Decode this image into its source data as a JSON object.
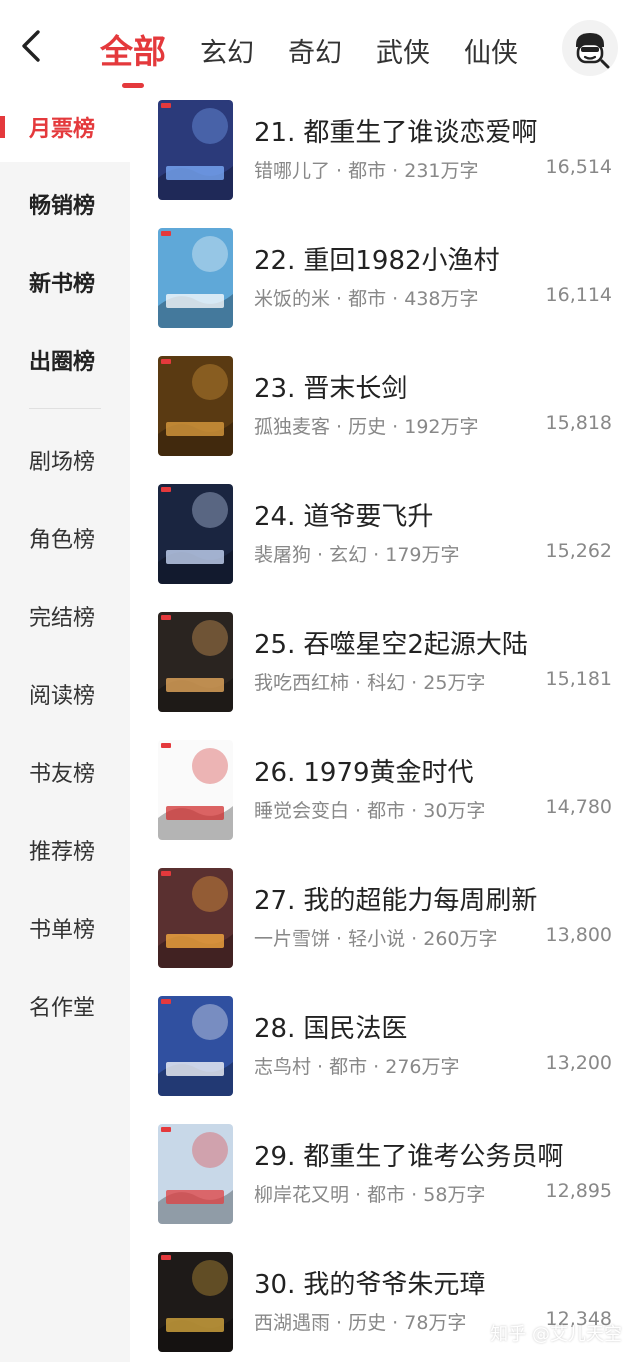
{
  "header": {
    "tabs": [
      {
        "label": "全部",
        "active": true
      },
      {
        "label": "玄幻",
        "active": false
      },
      {
        "label": "奇幻",
        "active": false
      },
      {
        "label": "武侠",
        "active": false
      },
      {
        "label": "仙侠",
        "active": false
      }
    ],
    "accent_color": "#e4393c"
  },
  "sidebar": {
    "items": [
      {
        "label": "月票榜"
      },
      {
        "label": "畅销榜"
      },
      {
        "label": "新书榜"
      },
      {
        "label": "出圈榜"
      },
      {
        "label": "剧场榜"
      },
      {
        "label": "角色榜"
      },
      {
        "label": "完结榜"
      },
      {
        "label": "阅读榜"
      },
      {
        "label": "书友榜"
      },
      {
        "label": "推荐榜"
      },
      {
        "label": "书单榜"
      },
      {
        "label": "名作堂"
      }
    ]
  },
  "books": [
    {
      "rank": "21.",
      "title": "都重生了谁谈恋爱啊",
      "meta": "错哪儿了 · 都市 · 231万字",
      "votes": "16,514",
      "cover_color": "#2b3a7a",
      "cover_accent": "#7fb0ff"
    },
    {
      "rank": "22.",
      "title": "重回1982小渔村",
      "meta": "米饭的米 · 都市 · 438万字",
      "votes": "16,114",
      "cover_color": "#5fa8d8",
      "cover_accent": "#ffffff"
    },
    {
      "rank": "23.",
      "title": "晋末长剑",
      "meta": "孤独麦客 · 历史 · 192万字",
      "votes": "15,818",
      "cover_color": "#5a3a12",
      "cover_accent": "#e0a040"
    },
    {
      "rank": "24.",
      "title": "道爷要飞升",
      "meta": "裴屠狗 · 玄幻 · 179万字",
      "votes": "15,262",
      "cover_color": "#1a2540",
      "cover_accent": "#d0e0ff"
    },
    {
      "rank": "25.",
      "title": "吞噬星空2起源大陆",
      "meta": "我吃西红柿 · 科幻 · 25万字",
      "votes": "15,181",
      "cover_color": "#2a2420",
      "cover_accent": "#f0b060"
    },
    {
      "rank": "26.",
      "title": "1979黄金时代",
      "meta": "睡觉会变白 · 都市 · 30万字",
      "votes": "14,780",
      "cover_color": "#fafafa",
      "cover_accent": "#d03030"
    },
    {
      "rank": "27.",
      "title": "我的超能力每周刷新",
      "meta": "一片雪饼 · 轻小说 · 260万字",
      "votes": "13,800",
      "cover_color": "#5a3030",
      "cover_accent": "#ffb040"
    },
    {
      "rank": "28.",
      "title": "国民法医",
      "meta": "志鸟村 · 都市 · 276万字",
      "votes": "13,200",
      "cover_color": "#3050a0",
      "cover_accent": "#ffffff"
    },
    {
      "rank": "29.",
      "title": "都重生了谁考公务员啊",
      "meta": "柳岸花又明 · 都市 · 58万字",
      "votes": "12,895",
      "cover_color": "#c8d8e8",
      "cover_accent": "#e04040"
    },
    {
      "rank": "30.",
      "title": "我的爷爷朱元璋",
      "meta": "西湖遇雨 · 历史 · 78万字",
      "votes": "12,348",
      "cover_color": "#1e1a18",
      "cover_accent": "#e0b040"
    }
  ],
  "watermark": "知乎 @艾儿天空"
}
